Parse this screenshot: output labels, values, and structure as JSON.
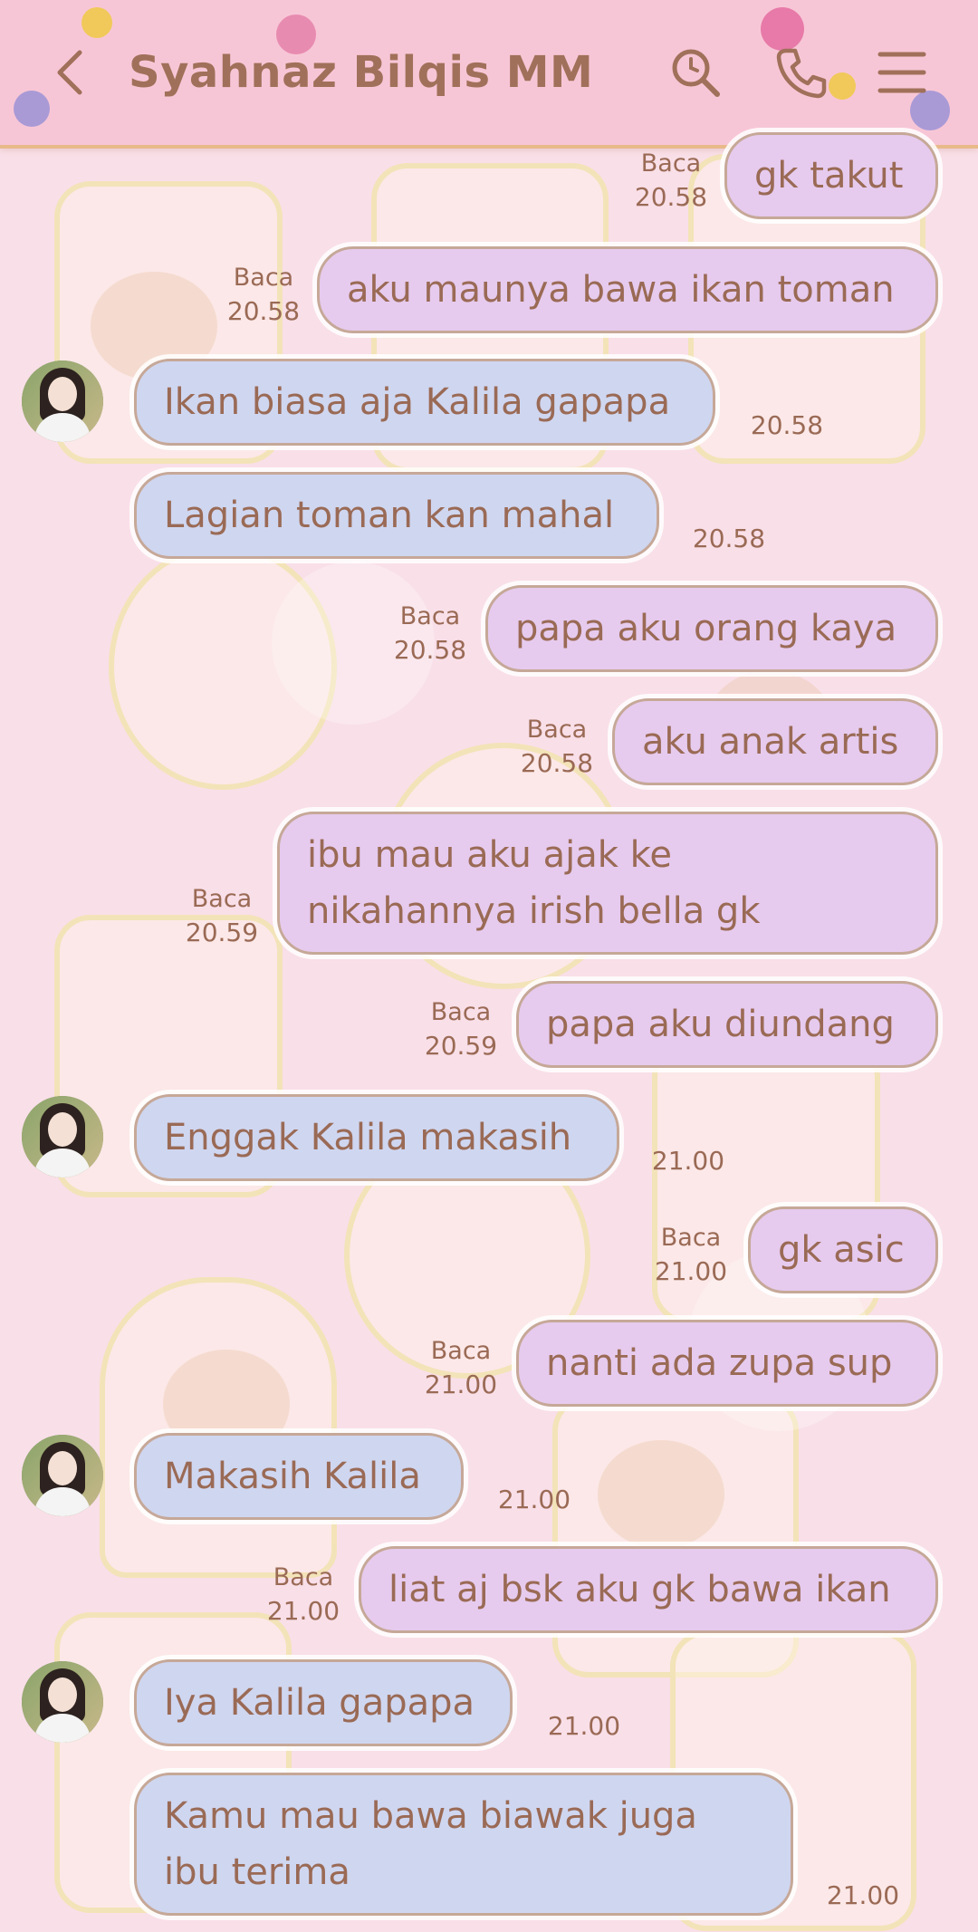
{
  "header": {
    "title": "Syahnaz Bilqis MM",
    "back_icon": "chevron-left-icon",
    "search_icon": "search-icon",
    "call_icon": "phone-icon",
    "menu_icon": "menu-icon"
  },
  "colors": {
    "header_bg": "#f7c6d6",
    "background": "#f9dfe8",
    "my_bubble": "#e6cbee",
    "their_bubble": "#cfd6f0",
    "text": "#9a6a55"
  },
  "messages": [
    {
      "side": "me",
      "lines": [
        "gk takut"
      ],
      "read": "Baca",
      "time": "20.58"
    },
    {
      "side": "me",
      "lines": [
        "aku maunya bawa ikan toman"
      ],
      "read": "Baca",
      "time": "20.58"
    },
    {
      "side": "them",
      "lines": [
        "Ikan biasa aja Kalila gapapa"
      ],
      "time": "20.58",
      "avatar": true
    },
    {
      "side": "them",
      "lines": [
        "Lagian toman kan mahal"
      ],
      "time": "20.58"
    },
    {
      "side": "me",
      "lines": [
        "papa aku orang kaya"
      ],
      "read": "Baca",
      "time": "20.58"
    },
    {
      "side": "me",
      "lines": [
        "aku anak artis"
      ],
      "read": "Baca",
      "time": "20.58"
    },
    {
      "side": "me",
      "lines": [
        "ibu mau aku ajak ke",
        "nikahannya irish bella gk"
      ],
      "read": "Baca",
      "time": "20.59"
    },
    {
      "side": "me",
      "lines": [
        "papa aku diundang"
      ],
      "read": "Baca",
      "time": "20.59"
    },
    {
      "side": "them",
      "lines": [
        "Enggak Kalila makasih"
      ],
      "time": "21.00",
      "avatar": true
    },
    {
      "side": "me",
      "lines": [
        "gk asic"
      ],
      "read": "Baca",
      "time": "21.00"
    },
    {
      "side": "me",
      "lines": [
        "nanti ada zupa sup"
      ],
      "read": "Baca",
      "time": "21.00"
    },
    {
      "side": "them",
      "lines": [
        "Makasih Kalila"
      ],
      "time": "21.00",
      "avatar": true
    },
    {
      "side": "me",
      "lines": [
        "liat aj bsk aku gk bawa ikan"
      ],
      "read": "Baca",
      "time": "21.00"
    },
    {
      "side": "them",
      "lines": [
        "Iya Kalila gapapa"
      ],
      "time": "21.00",
      "avatar": true
    },
    {
      "side": "them",
      "lines": [
        "Kamu mau bawa biawak juga",
        "ibu terima"
      ],
      "time": "21.00"
    }
  ]
}
